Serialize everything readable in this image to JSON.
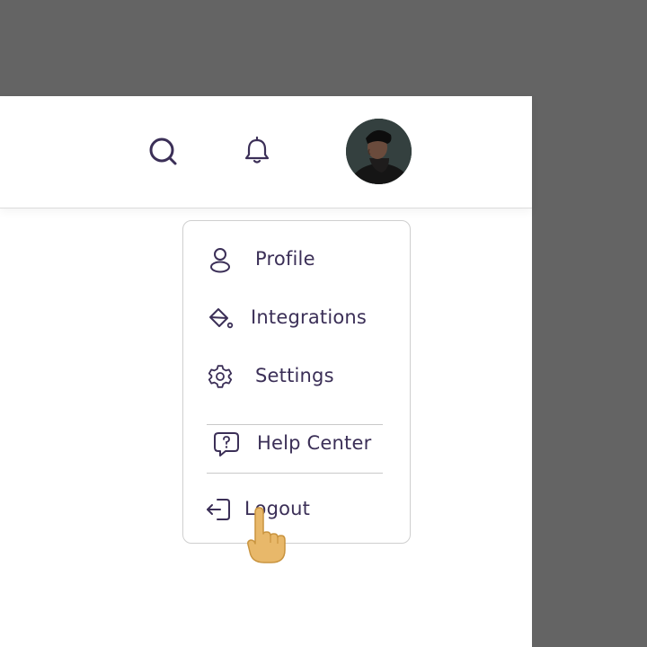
{
  "header": {
    "search_icon": "search-icon",
    "notification_icon": "bell-icon",
    "avatar": "user-avatar-photo"
  },
  "menu": {
    "items": [
      {
        "label": "Profile",
        "icon": "person-icon"
      },
      {
        "label": "Integrations",
        "icon": "paint-bucket-icon"
      },
      {
        "label": "Settings",
        "icon": "gear-icon"
      },
      {
        "label": "Help Center",
        "icon": "help-chat-icon"
      },
      {
        "label": "Logout",
        "icon": "logout-icon"
      }
    ]
  },
  "colors": {
    "backdrop": "#646464",
    "surface": "#ffffff",
    "accent_text": "#3b2f57",
    "border": "#cfcfcf",
    "cursor_fill": "#e8b86a"
  }
}
